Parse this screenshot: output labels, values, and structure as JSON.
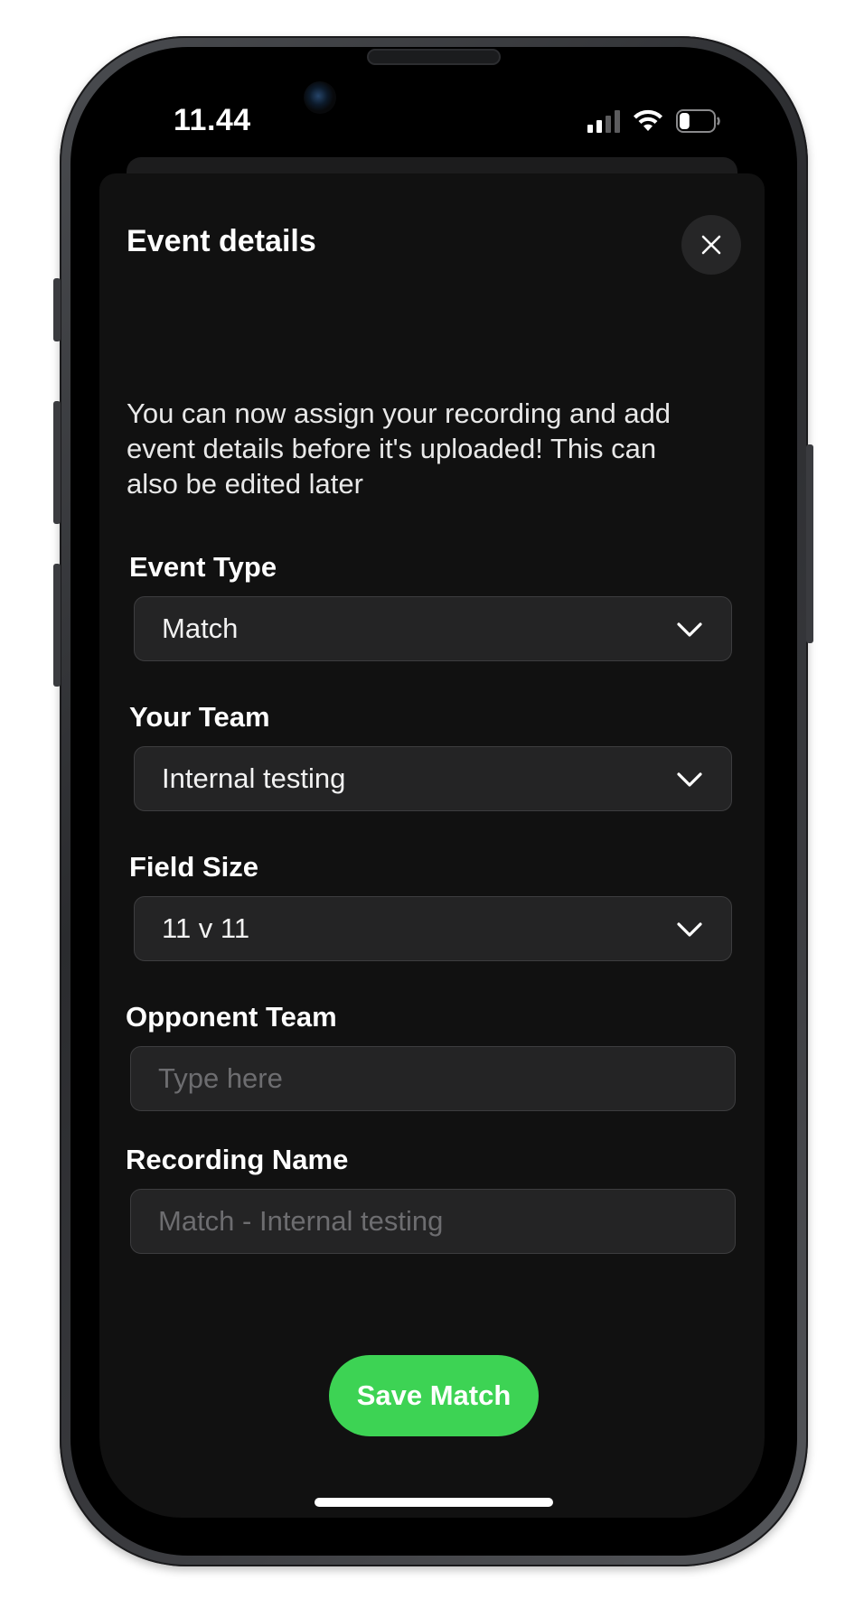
{
  "status_bar": {
    "time": "11.44",
    "signal_bars_active": 2,
    "signal_bars_total": 4,
    "battery_level_fraction": 0.3
  },
  "sheet": {
    "title": "Event details",
    "close_icon": "close-icon",
    "intro_text": "You can now assign your recording and add event details before it's uploaded! This can also be edited later"
  },
  "form": {
    "event_type": {
      "label": "Event Type",
      "value": "Match"
    },
    "your_team": {
      "label": "Your Team",
      "value": "Internal testing"
    },
    "field_size": {
      "label": "Field Size",
      "value": "11 v 11"
    },
    "opponent_team": {
      "label": "Opponent Team",
      "value": "",
      "placeholder": "Type here"
    },
    "recording_name": {
      "label": "Recording Name",
      "value": "",
      "placeholder": "Match - Internal testing"
    }
  },
  "actions": {
    "save_label": "Save Match"
  },
  "colors": {
    "sheet_background": "#111111",
    "field_background": "#242425",
    "accent_green": "#3dd354",
    "placeholder_text": "#6d6d70"
  }
}
